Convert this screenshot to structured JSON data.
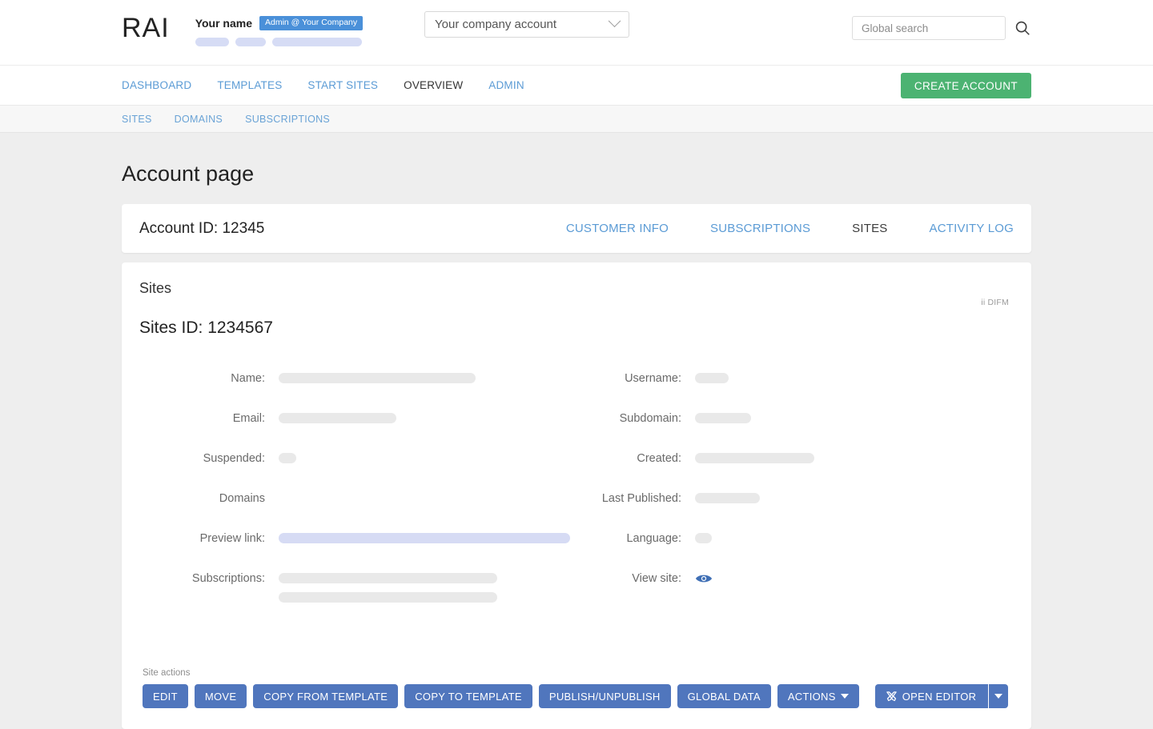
{
  "header": {
    "brand": "RAI",
    "user_name": "Your name",
    "role_badge": "Admin @ Your Company",
    "account_select_value": "Your company account",
    "search_placeholder": "Global search",
    "search_value": ""
  },
  "main_nav": {
    "items": [
      {
        "label": "DASHBOARD",
        "active": false
      },
      {
        "label": "TEMPLATES",
        "active": false
      },
      {
        "label": "START SITES",
        "active": false
      },
      {
        "label": "OVERVIEW",
        "active": true
      },
      {
        "label": "ADMIN",
        "active": false
      }
    ],
    "create_account_label": "CREATE ACCOUNT"
  },
  "sub_nav": {
    "items": [
      {
        "label": "SITES"
      },
      {
        "label": "DOMAINS"
      },
      {
        "label": "SUBSCRIPTIONS"
      }
    ]
  },
  "page": {
    "title": "Account page"
  },
  "account_card": {
    "account_id_label": "Account ID: 12345",
    "tabs": [
      {
        "label": "CUSTOMER INFO",
        "active": false
      },
      {
        "label": "SUBSCRIPTIONS",
        "active": false
      },
      {
        "label": "SITES",
        "active": true
      },
      {
        "label": "ACTIVITY LOG",
        "active": false
      }
    ]
  },
  "sites_card": {
    "heading": "Sites",
    "difm_label": "ii DIFM",
    "sites_id_label": "Sites ID: 1234567",
    "left_fields": [
      {
        "label": "Name:",
        "bars": [
          246
        ]
      },
      {
        "label": "Email:",
        "bars": [
          147
        ]
      },
      {
        "label": "Suspended:",
        "bars": [
          22
        ]
      },
      {
        "label": "Domains",
        "bars": []
      },
      {
        "label": "Preview link:",
        "bars": [
          364
        ],
        "accent": true
      },
      {
        "label": "Subscriptions:",
        "bars": [
          273,
          273
        ]
      }
    ],
    "right_fields": [
      {
        "label": "Username:",
        "bars": [
          42
        ]
      },
      {
        "label": "Subdomain:",
        "bars": [
          70
        ]
      },
      {
        "label": "Created:",
        "bars": [
          149
        ]
      },
      {
        "label": "Last Published:",
        "bars": [
          81
        ]
      },
      {
        "label": "Language:",
        "bars": [
          21
        ]
      },
      {
        "label": "View site:",
        "icon": "eye-icon"
      }
    ],
    "site_actions_label": "Site actions",
    "actions": [
      {
        "label": "EDIT",
        "name": "edit-button"
      },
      {
        "label": "MOVE",
        "name": "move-button"
      },
      {
        "label": "COPY FROM TEMPLATE",
        "name": "copy-from-template-button"
      },
      {
        "label": "COPY TO TEMPLATE",
        "name": "copy-to-template-button"
      },
      {
        "label": "PUBLISH/UNPUBLISH",
        "name": "publish-unpublish-button"
      },
      {
        "label": "GLOBAL DATA",
        "name": "global-data-button"
      }
    ],
    "actions_dropdown_label": "ACTIONS",
    "open_editor_label": "OPEN EDITOR"
  },
  "colors": {
    "page_background": "#eeeeee",
    "link_blue": "#5b9bd5",
    "create_green": "#4cb372",
    "action_blue": "#5076bd",
    "badge_blue": "#4a90d9",
    "placeholder_gray": "#e9e9e9",
    "placeholder_lavender": "#d6dbf4"
  }
}
